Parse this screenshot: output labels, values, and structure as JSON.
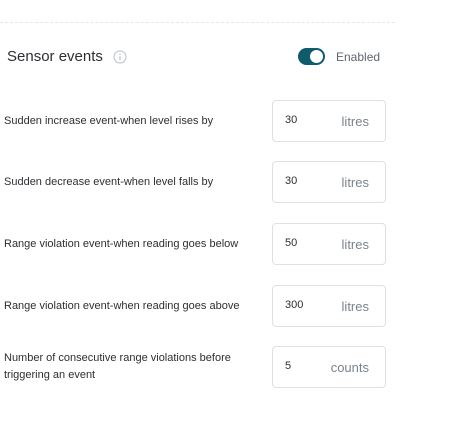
{
  "section": {
    "title": "Sensor events",
    "info_icon": "info-circle-icon",
    "toggle": {
      "label": "Enabled",
      "on": true
    },
    "colors": {
      "toggle_on": "#0f5a6b",
      "border": "#dde1e5",
      "unit_text": "#7a838c"
    }
  },
  "rows": [
    {
      "label": "Sudden increase event-when level rises by",
      "value": "30",
      "unit": "litres"
    },
    {
      "label": "Sudden decrease event-when level falls by",
      "value": "30",
      "unit": "litres"
    },
    {
      "label": "Range violation event-when reading goes below",
      "value": "50",
      "unit": "litres"
    },
    {
      "label": "Range violation event-when reading goes above",
      "value": "300",
      "unit": "litres"
    },
    {
      "label": "Number of consecutive range violations before triggering an event",
      "value": "5",
      "unit": "counts"
    }
  ]
}
